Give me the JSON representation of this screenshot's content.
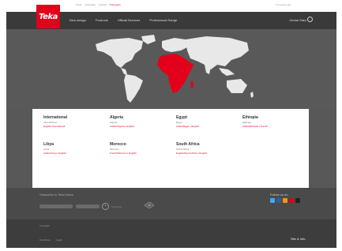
{
  "header": {
    "top_links": [
      "Press",
      "Corporate",
      "Contact",
      "Português"
    ],
    "top_right": "Corporate site",
    "logo": "Teka"
  },
  "nav": {
    "items": [
      "New design",
      "Products",
      "Official Services",
      "Professional Range"
    ],
    "right_label": "Global Sites",
    "search_icon": "search-icon"
  },
  "countries": [
    {
      "name": "International",
      "local": "International",
      "langs": "English International"
    },
    {
      "name": "Algeria",
      "local": "Algeria",
      "langs": "Arabic/Algeria | English"
    },
    {
      "name": "Egypt",
      "local": "Egypt",
      "langs": "Arabic/Egypt | English"
    },
    {
      "name": "Ethiopia",
      "local": "Ethiopia",
      "langs": "Arabic/Ethiopia | French"
    },
    {
      "name": "Libya",
      "local": "Libya",
      "langs": "Arabic/Libya | English"
    },
    {
      "name": "Morocco",
      "local": "Morocco",
      "langs": "French/Morocco | English"
    },
    {
      "name": "South Africa",
      "local": "South Africa",
      "langs": "English/South Africa | English"
    }
  ],
  "footer": {
    "newsletter_label": "Subscribe to Teka News",
    "button_icon": "arrow-icon",
    "small_text": "Subscribe",
    "follow_label": "Follow us on",
    "social_icons": [
      {
        "name": "twitter-icon",
        "color": "#3fa9f5"
      },
      {
        "name": "facebook-icon",
        "color": "#3b5998"
      },
      {
        "name": "rss-icon",
        "color": "#f7931e"
      },
      {
        "name": "youtube-icon",
        "color": "#e2001a"
      },
      {
        "name": "flickr-icon",
        "color": "#222222"
      }
    ],
    "bottom_label": "Copyright",
    "bottom_links": [
      "Disclaimer",
      "Legal"
    ],
    "bottom_right": "Site & Info"
  },
  "colors": {
    "brand_red": "#e2001a",
    "map_land": "#e8e8e8",
    "map_highlight": "#e2001a"
  }
}
